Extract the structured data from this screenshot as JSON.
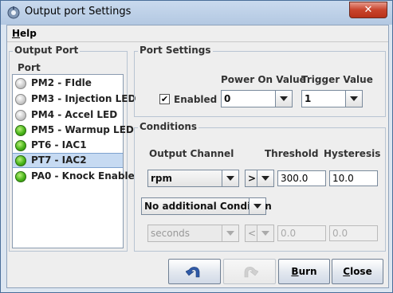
{
  "window": {
    "title": "Output port Settings",
    "close_glyph": "✕"
  },
  "menu": {
    "help_label": "Help",
    "help_mnemonic": "H",
    "help_rest": "elp"
  },
  "output_port": {
    "group_title": "Output Port",
    "list_label": "Port",
    "items": [
      {
        "label": "PM2 - FIdle",
        "led": "off"
      },
      {
        "label": "PM3 - Injection LED",
        "led": "off"
      },
      {
        "label": "PM4 - Accel LED",
        "led": "off"
      },
      {
        "label": "PM5 - Warmup LED",
        "led": "on"
      },
      {
        "label": "PT6 - IAC1",
        "led": "on"
      },
      {
        "label": "PT7 - IAC2",
        "led": "on",
        "selected": true
      },
      {
        "label": "PA0 - Knock Enable",
        "led": "on"
      }
    ]
  },
  "port_settings": {
    "group_title": "Port Settings",
    "enabled_label": "Enabled",
    "enabled_checked": true,
    "check_glyph": "✔",
    "power_on_label": "Power On Value",
    "power_on_value": "0",
    "trigger_label": "Trigger Value",
    "trigger_value": "1"
  },
  "conditions": {
    "group_title": "Conditions",
    "output_channel_label": "Output Channel",
    "threshold_label": "Threshold",
    "hysteresis_label": "Hysteresis",
    "row1": {
      "channel": "rpm",
      "operator": ">",
      "threshold": "300.0",
      "hysteresis": "10.0"
    },
    "additional_condition": "No additional Condition",
    "row2": {
      "channel": "seconds",
      "operator": "<",
      "threshold": "0.0",
      "hysteresis": "0.0"
    }
  },
  "buttons": {
    "burn_mnemonic": "B",
    "burn_rest": "urn",
    "close_mnemonic": "C",
    "close_rest": "lose"
  },
  "colors": {
    "led_on": "#49b51a",
    "led_off": "#c8c8c8",
    "selection": "#c6daf2",
    "title_close": "#c8432b"
  }
}
